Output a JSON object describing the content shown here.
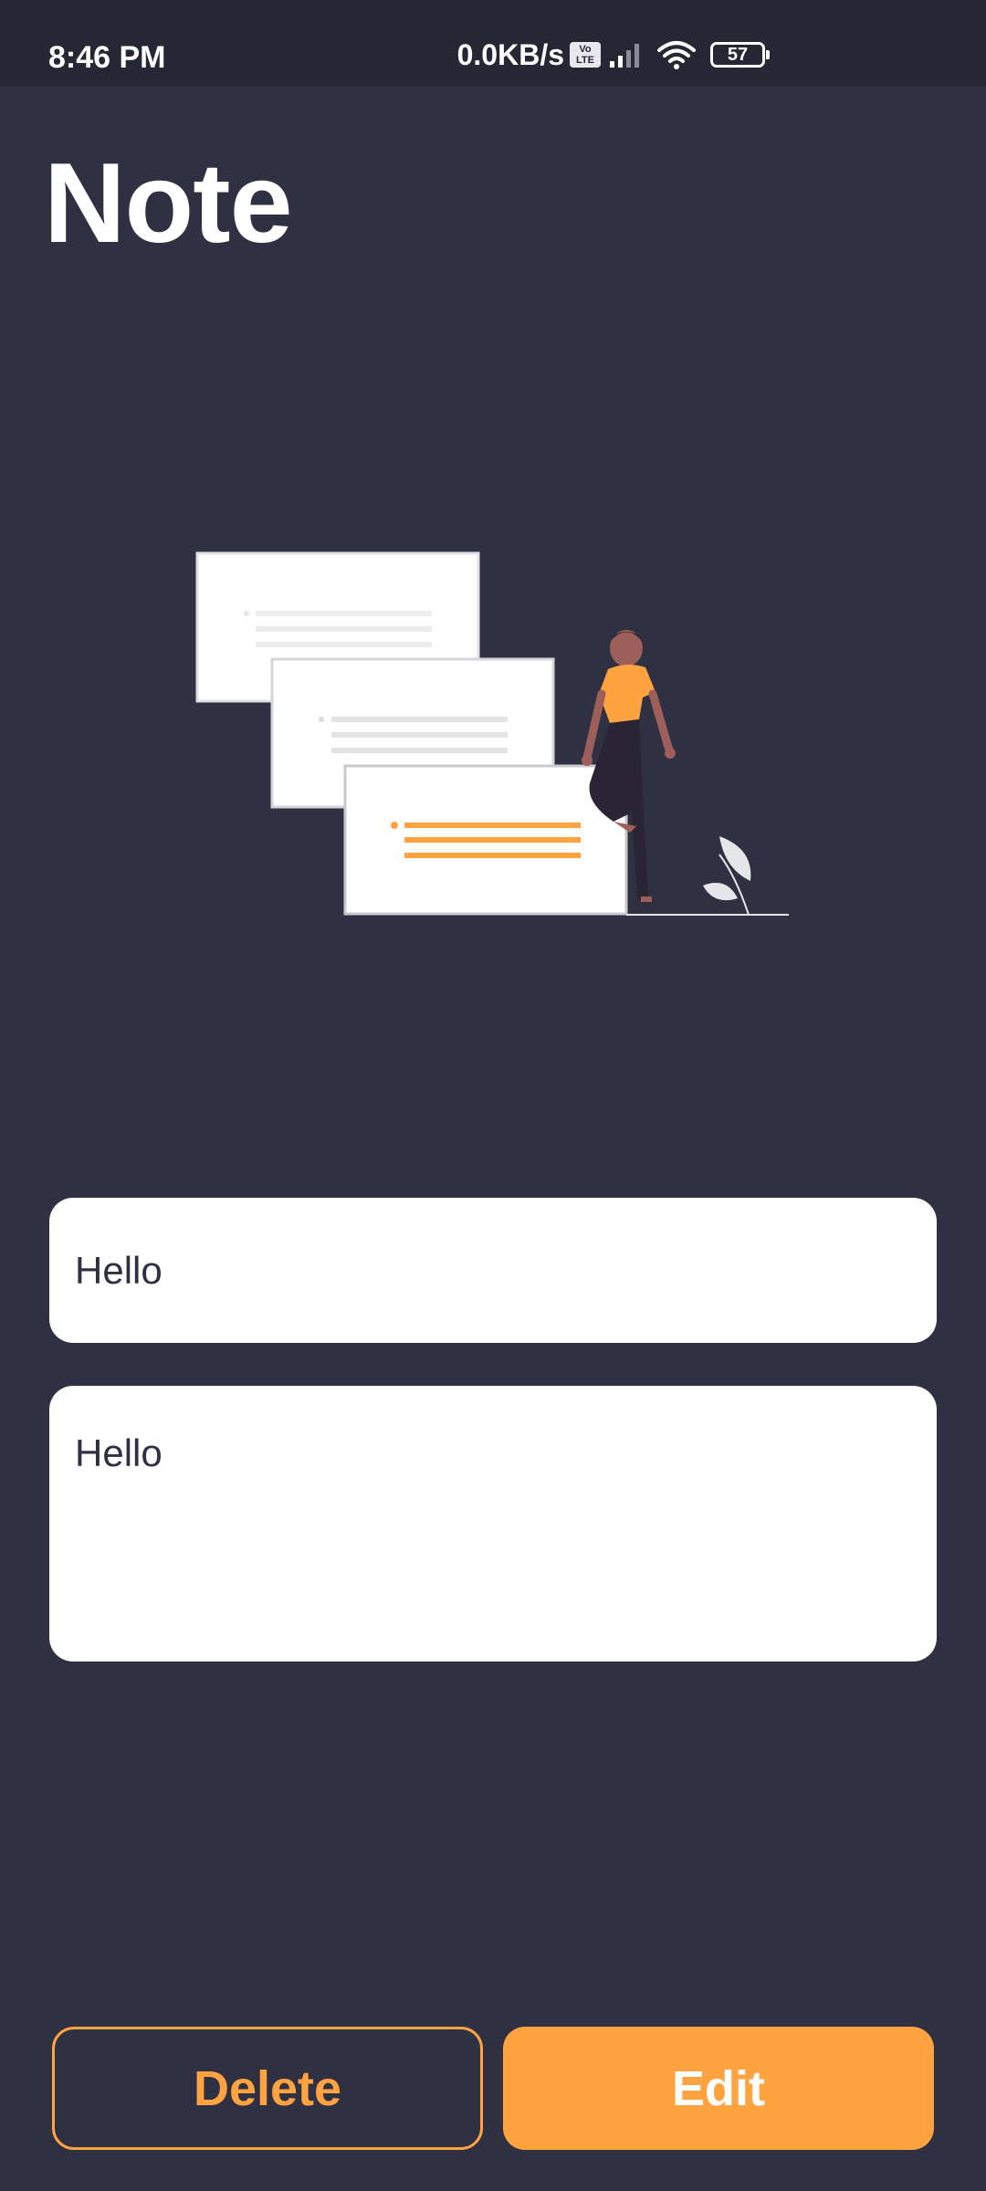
{
  "status_bar": {
    "time": "8:46 PM",
    "net_speed": "0.0KB/s",
    "volte_label": "Vo LTE",
    "battery_level": "57"
  },
  "header": {
    "title": "Note"
  },
  "illustration": {
    "icon": "notes-illustration",
    "accent_color": "#ffa341"
  },
  "form": {
    "title_value": "Hello",
    "body_value": "Hello"
  },
  "actions": {
    "delete_label": "Delete",
    "edit_label": "Edit"
  },
  "colors": {
    "background": "#2f3142",
    "status_bar": "#262735",
    "accent": "#ffa341",
    "field_bg": "#ffffff"
  }
}
